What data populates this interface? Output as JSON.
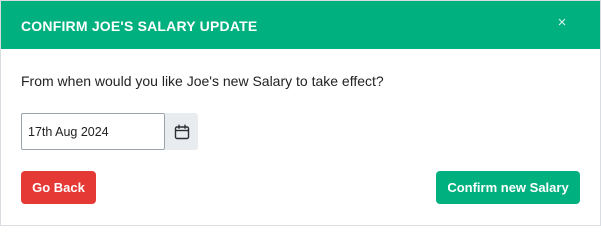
{
  "dialog": {
    "title": "CONFIRM JOE'S SALARY UPDATE",
    "close_glyph": "×",
    "question": "From when would you like Joe's new Salary to take effect?",
    "date_value": "17th Aug 2024",
    "back_label": "Go Back",
    "confirm_label": "Confirm new Salary"
  },
  "colors": {
    "header": "#00b07f",
    "back_button": "#e53935",
    "confirm_button": "#00b07f"
  },
  "icons": {
    "close": "close-icon",
    "calendar": "calendar-icon"
  }
}
